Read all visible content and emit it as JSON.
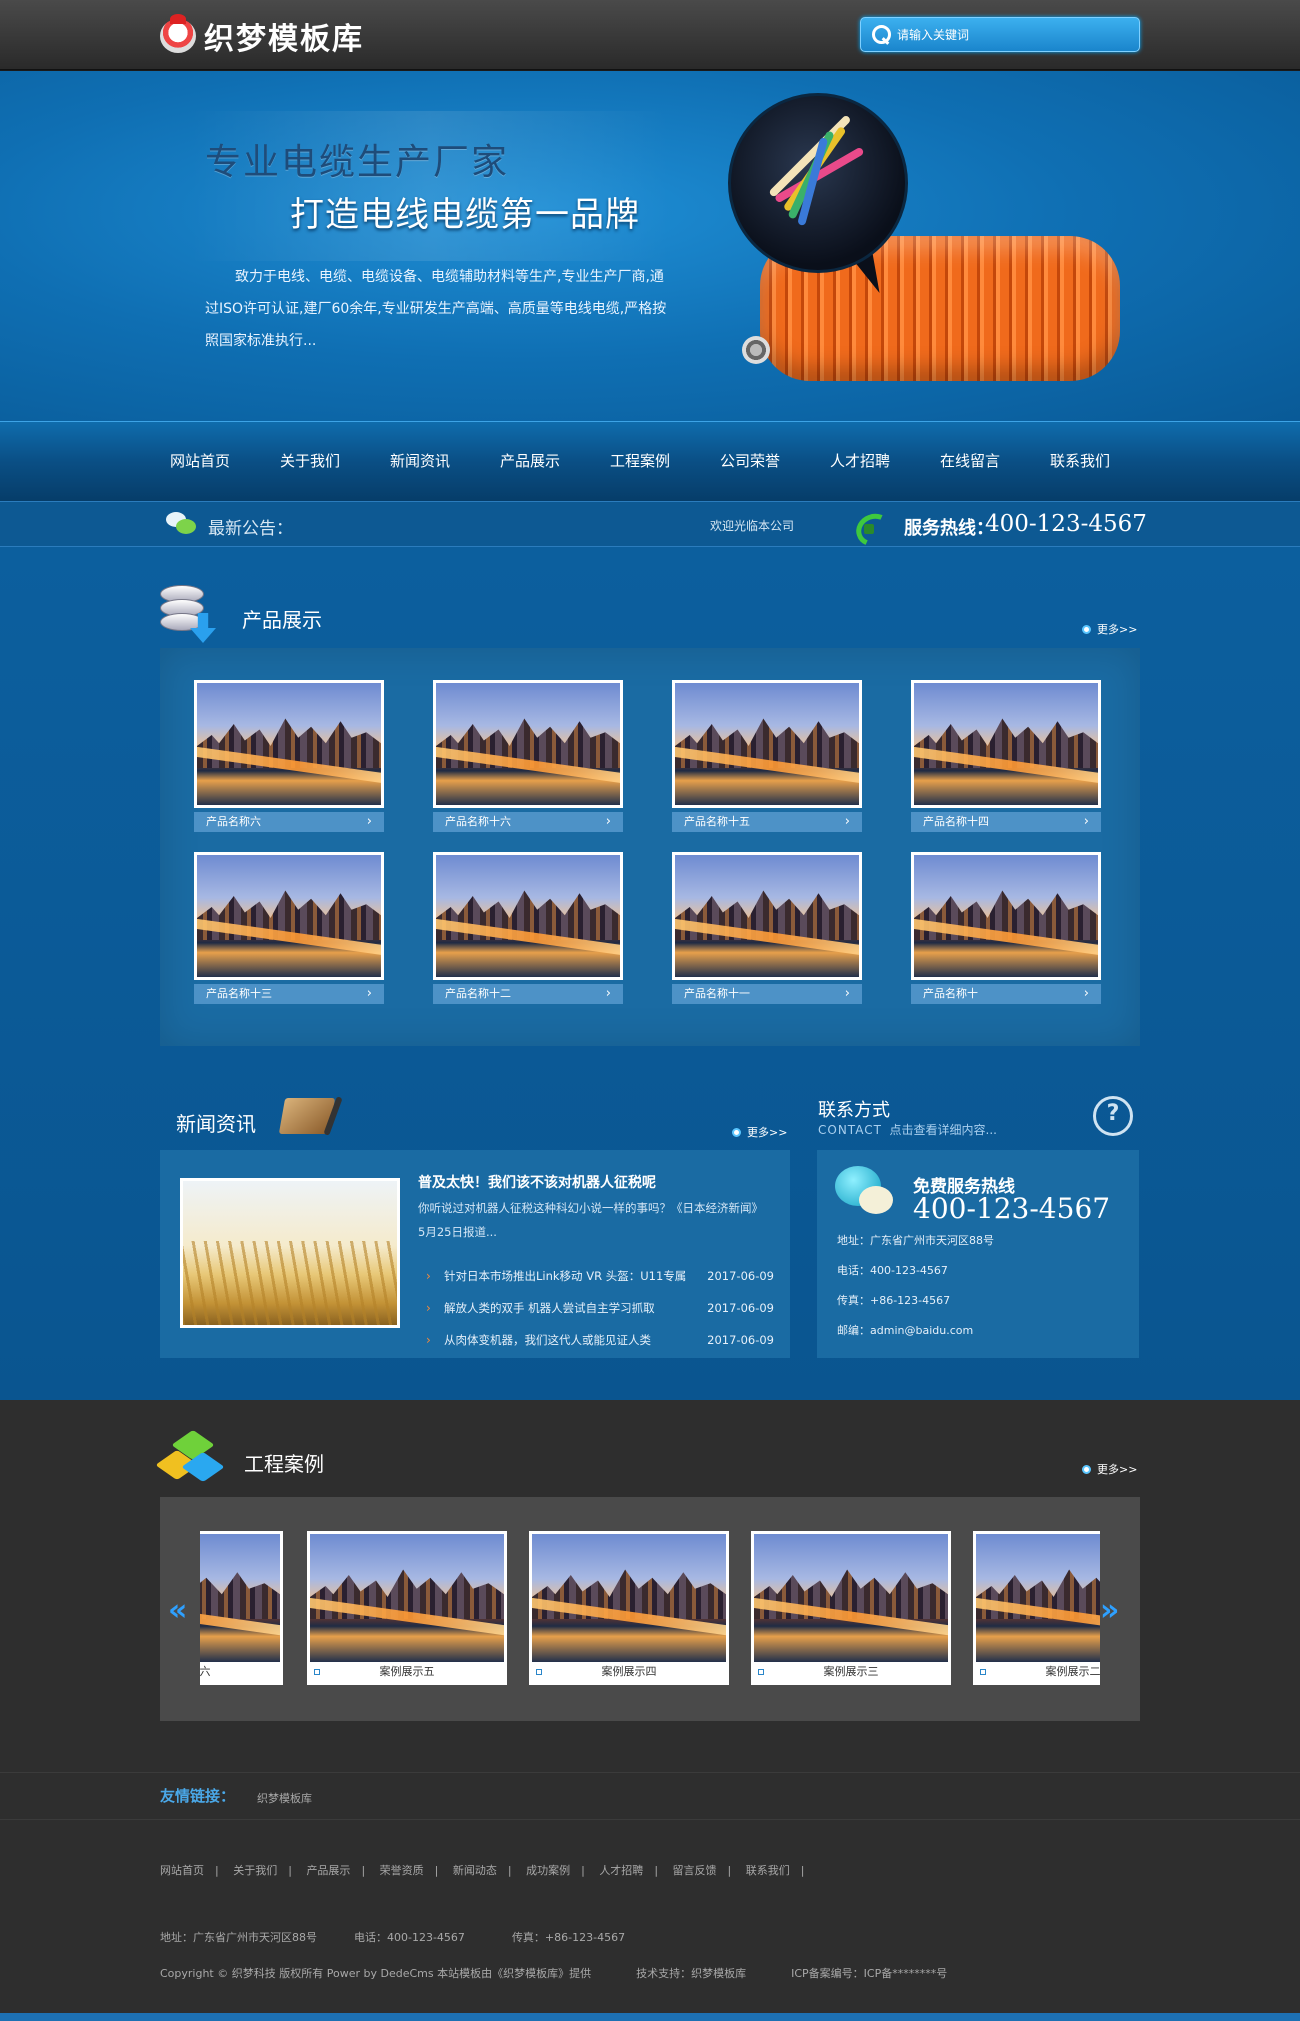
{
  "header": {
    "logo_text": "织梦模板库",
    "search_placeholder": "请输入关键词"
  },
  "banner": {
    "headline": "专业电缆生产厂家",
    "subheadline": "打造电线电缆第一品牌",
    "description": "致力于电线、电缆、电缆设备、电缆辅助材料等生产,专业生产厂商,通过ISO许可认证,建厂60余年,专业研发生产高端、高质量等电线电缆,严格按照国家标准执行..."
  },
  "nav": {
    "items": [
      "网站首页",
      "关于我们",
      "新闻资讯",
      "产品展示",
      "工程案例",
      "公司荣誉",
      "人才招聘",
      "在线留言",
      "联系我们"
    ]
  },
  "notice": {
    "label": "最新公告：",
    "text": "欢迎光临本公司",
    "hotline_label": "服务热线：",
    "hotline_number": "400-123-4567"
  },
  "products": {
    "title": "产品展示",
    "more": "更多>>",
    "items": [
      "产品名称六",
      "产品名称十六",
      "产品名称十五",
      "产品名称十四",
      "产品名称十三",
      "产品名称十二",
      "产品名称十一",
      "产品名称十"
    ]
  },
  "news": {
    "title": "新闻资讯",
    "more": "更多>>",
    "featured_title": "普及太快！我们该不该对机器人征税呢",
    "featured_summary": "你听说过对机器人征税这种科幻小说一样的事吗？《日本经济新闻》5月25日报道...",
    "list": [
      {
        "title": "针对日本市场推出Link移动 VR 头盔：U11专属",
        "date": "2017-06-09"
      },
      {
        "title": "解放人类的双手 机器人尝试自主学习抓取",
        "date": "2017-06-09"
      },
      {
        "title": "从肉体变机器，我们这代人或能见证人类",
        "date": "2017-06-09"
      }
    ]
  },
  "contact": {
    "title": "联系方式",
    "subtitle_en": "CONTACT",
    "subtitle_cn": "点击查看详细内容...",
    "free_label": "免费服务热线",
    "free_number": "400-123-4567",
    "address": "地址：广东省广州市天河区88号",
    "phone": "电话：400-123-4567",
    "fax": "传真：+86-123-4567",
    "email": "邮编：admin@baidu.com"
  },
  "cases": {
    "title": "工程案例",
    "more": "更多>>",
    "items": [
      "案例展示六",
      "案例展示五",
      "案例展示四",
      "案例展示三",
      "案例展示二"
    ]
  },
  "links": {
    "label": "友情链接：",
    "items": [
      "织梦模板库"
    ]
  },
  "footer": {
    "nav": [
      "网站首页",
      "关于我们",
      "产品展示",
      "荣誉资质",
      "新闻动态",
      "成功案例",
      "人才招聘",
      "留言反馈",
      "联系我们"
    ],
    "address": "地址：广东省广州市天河区88号",
    "phone": "电话：400-123-4567",
    "fax": "传真：+86-123-4567",
    "copyright": "Copyright © 织梦科技 版权所有 Power by DedeCms 本站模板由《织梦模板库》提供",
    "support": "技术支持：织梦模板库",
    "icp": "ICP备案编号：ICP备********号"
  }
}
